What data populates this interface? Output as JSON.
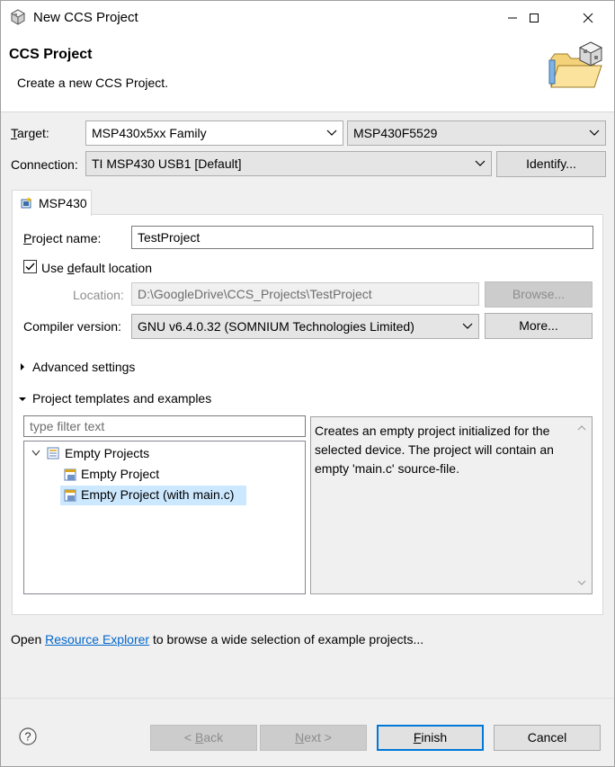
{
  "window": {
    "title": "New CCS Project",
    "app_icon": "ccs-cube-icon"
  },
  "banner": {
    "title": "CCS Project",
    "description": "Create a new CCS Project.",
    "icon": "folder-cube-icon"
  },
  "target": {
    "label_prefix": "T",
    "label_rest": "arget:",
    "family_value": "MSP430x5xx Family",
    "device_value": "MSP430F5529"
  },
  "connection": {
    "label": "Connection:",
    "value": "TI MSP430 USB1 [Default]",
    "identify_button": "Identify..."
  },
  "tab": {
    "label": "MSP430",
    "icon": "chip-icon"
  },
  "project_name": {
    "label_prefix": "P",
    "label_rest": "roject name:",
    "value": "TestProject"
  },
  "default_location": {
    "label_pre": "Use ",
    "label_u": "d",
    "label_post": "efault location",
    "checked": true
  },
  "location": {
    "label": "Location:",
    "value": "D:\\GoogleDrive\\CCS_Projects\\TestProject",
    "browse_button": "Browse..."
  },
  "compiler": {
    "label": "Compiler version:",
    "value": "GNU v6.4.0.32 (SOMNIUM Technologies Limited)",
    "more_button": "More..."
  },
  "advanced_settings": {
    "label": "Advanced settings",
    "expanded": false
  },
  "templates": {
    "label": "Project templates and examples",
    "expanded": true,
    "filter_placeholder": "type filter text",
    "tree": [
      {
        "label": "Empty Projects",
        "level": 0,
        "expanded": true
      },
      {
        "label": "Empty Project",
        "level": 1,
        "selected": false
      },
      {
        "label": "Empty Project (with main.c)",
        "level": 1,
        "selected": true
      }
    ],
    "description": "Creates an empty project initialized for the selected device. The project will contain an empty 'main.c' source-file."
  },
  "footer": {
    "text_before": "Open ",
    "link_text": "Resource Explorer",
    "text_after": " to browse a wide selection of example projects..."
  },
  "buttons": {
    "back": {
      "pre": "< ",
      "u": "B",
      "post": "ack",
      "enabled": false
    },
    "next": {
      "pre": "",
      "u": "N",
      "post": "ext >",
      "enabled": false
    },
    "finish": {
      "pre": "",
      "u": "F",
      "post": "inish",
      "enabled": true
    },
    "cancel": "Cancel"
  },
  "colors": {
    "link": "#0066cc",
    "selection": "#cce8ff",
    "default_button_border": "#0078d7"
  }
}
